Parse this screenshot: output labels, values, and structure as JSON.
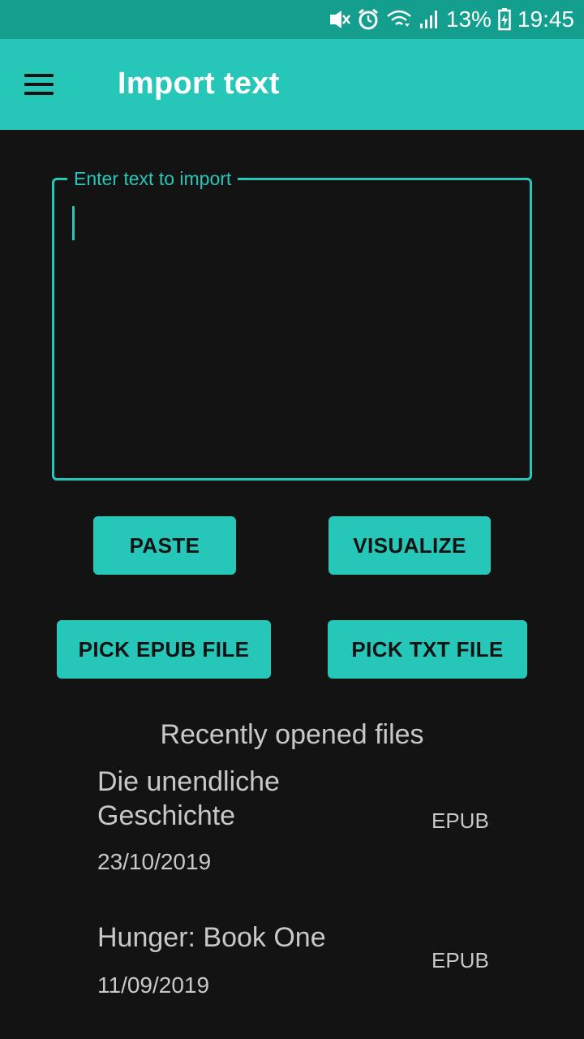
{
  "status_bar": {
    "battery": "13%",
    "time": "19:45",
    "icons": [
      "vibrate-mute-icon",
      "alarm-icon",
      "wifi-icon",
      "signal-icon",
      "battery-charging-icon"
    ]
  },
  "app_bar": {
    "menu_icon": "hamburger-menu-icon",
    "title": "Import text"
  },
  "import_field": {
    "label": "Enter text to import",
    "value": ""
  },
  "buttons": {
    "paste": "PASTE",
    "visualize": "VISUALIZE",
    "pick_epub": "PICK EPUB FILE",
    "pick_txt": "PICK TXT FILE"
  },
  "recent": {
    "title": "Recently opened files",
    "items": [
      {
        "name": "Die unendliche Geschichte",
        "date": "23/10/2019",
        "type": "EPUB"
      },
      {
        "name": "Hunger: Book One",
        "date": "11/09/2019",
        "type": "EPUB"
      }
    ]
  },
  "colors": {
    "accent": "#26c6b9",
    "status_bar": "#139e8e",
    "background": "#131313",
    "text_secondary": "#c8c8c8"
  }
}
